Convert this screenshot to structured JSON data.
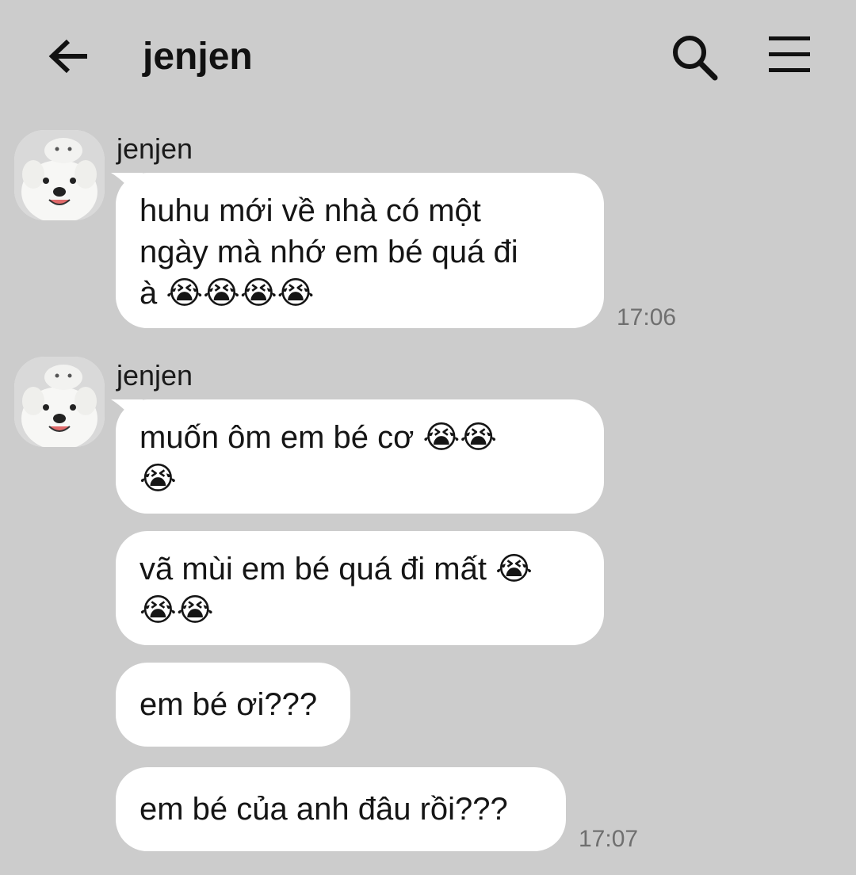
{
  "header": {
    "title": "jenjen"
  },
  "icons": {
    "back": "back-arrow-icon",
    "search": "search-icon",
    "menu": "hamburger-menu-icon"
  },
  "colors": {
    "background": "#cccccc",
    "bubble": "#ffffff",
    "timestamp": "#6f6f6f"
  },
  "groups": [
    {
      "sender": "jenjen",
      "messages": [
        {
          "lines": [
            "huhu mới về nhà có một",
            "ngày mà nhớ em bé quá đi",
            "à 😭😭😭😭"
          ],
          "time": "17:06"
        }
      ]
    },
    {
      "sender": "jenjen",
      "messages": [
        {
          "lines": [
            "muốn ôm em bé cơ 😭😭",
            "😭"
          ]
        },
        {
          "lines": [
            "vã mùi em bé quá đi mất 😭",
            "😭😭"
          ]
        },
        {
          "lines": [
            "em bé ơi???"
          ]
        },
        {
          "lines": [
            "em bé của anh đâu rồi???"
          ],
          "time": "17:07"
        }
      ]
    }
  ]
}
